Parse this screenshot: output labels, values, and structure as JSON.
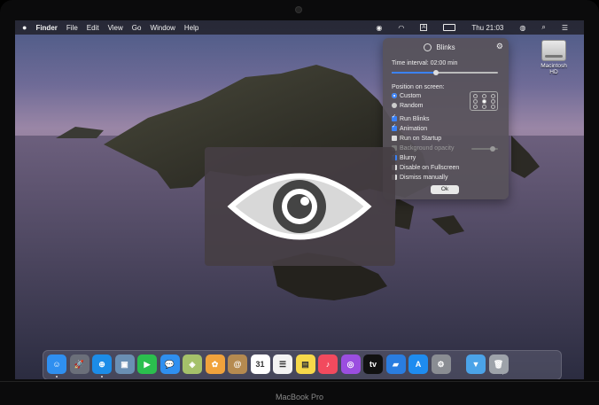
{
  "menubar": {
    "apple": "",
    "app_name": "Finder",
    "items": [
      "File",
      "Edit",
      "View",
      "Go",
      "Window",
      "Help"
    ],
    "clock": "Thu 21:03"
  },
  "desktop": {
    "disk_label": "Macintosh HD"
  },
  "blinks_panel": {
    "title": "Blinks",
    "time_interval_label": "Time interval: 02:00 min",
    "time_interval_fraction": 0.42,
    "position_label": "Position on screen:",
    "position_options": [
      {
        "label": "Custom",
        "selected": true
      },
      {
        "label": "Random",
        "selected": false
      }
    ],
    "options": [
      {
        "label": "Run Blinks",
        "checked": true,
        "enabled": true
      },
      {
        "label": "Animation",
        "checked": true,
        "enabled": true
      },
      {
        "label": "Run on Startup",
        "checked": false,
        "enabled": true
      },
      {
        "label": "Background opacity",
        "checked": false,
        "enabled": false
      },
      {
        "label": "Blurry",
        "checked": true,
        "enabled": true
      },
      {
        "label": "Disable on Fullscreen",
        "checked": false,
        "enabled": true
      },
      {
        "label": "Dismiss manually",
        "checked": false,
        "enabled": true
      }
    ],
    "opacity_fraction": 0.8,
    "ok_label": "Ok"
  },
  "dock": {
    "apps": [
      {
        "name": "finder-icon",
        "color": "#2f8ff0",
        "glyph": "☺"
      },
      {
        "name": "launchpad-icon",
        "color": "#6b6f7a",
        "glyph": "🚀"
      },
      {
        "name": "safari-icon",
        "color": "#1c8ce8",
        "glyph": "⊕"
      },
      {
        "name": "preview-icon",
        "color": "#6a8fb3",
        "glyph": "▣"
      },
      {
        "name": "facetime-icon",
        "color": "#2bbf4e",
        "glyph": "▶"
      },
      {
        "name": "messages-icon",
        "color": "#2f8ff0",
        "glyph": "💬"
      },
      {
        "name": "maps-icon",
        "color": "#a5c16a",
        "glyph": "◈"
      },
      {
        "name": "photos-icon",
        "color": "#f0a23c",
        "glyph": "✿"
      },
      {
        "name": "contacts-icon",
        "color": "#b58a50",
        "glyph": "@"
      },
      {
        "name": "calendar-icon",
        "color": "#ffffff",
        "glyph": "31"
      },
      {
        "name": "reminders-icon",
        "color": "#f3f3f3",
        "glyph": "☰"
      },
      {
        "name": "notes-icon",
        "color": "#f6d84a",
        "glyph": "▤"
      },
      {
        "name": "music-icon",
        "color": "#f24a5e",
        "glyph": "♪"
      },
      {
        "name": "podcasts-icon",
        "color": "#9b4ee0",
        "glyph": "◎"
      },
      {
        "name": "tv-icon",
        "color": "#111111",
        "glyph": "tv"
      },
      {
        "name": "keynote-icon",
        "color": "#2a7de0",
        "glyph": "▰"
      },
      {
        "name": "app-store-icon",
        "color": "#1e8cf0",
        "glyph": "A"
      },
      {
        "name": "system-preferences-icon",
        "color": "#8a8d93",
        "glyph": "⚙"
      },
      {
        "name": "downloads-folder-icon",
        "color": "#4ba3e8",
        "glyph": "▼"
      },
      {
        "name": "trash-icon",
        "color": "#9ea3aa",
        "glyph": "🗑"
      }
    ]
  },
  "chin": {
    "label": "MacBook Pro"
  }
}
